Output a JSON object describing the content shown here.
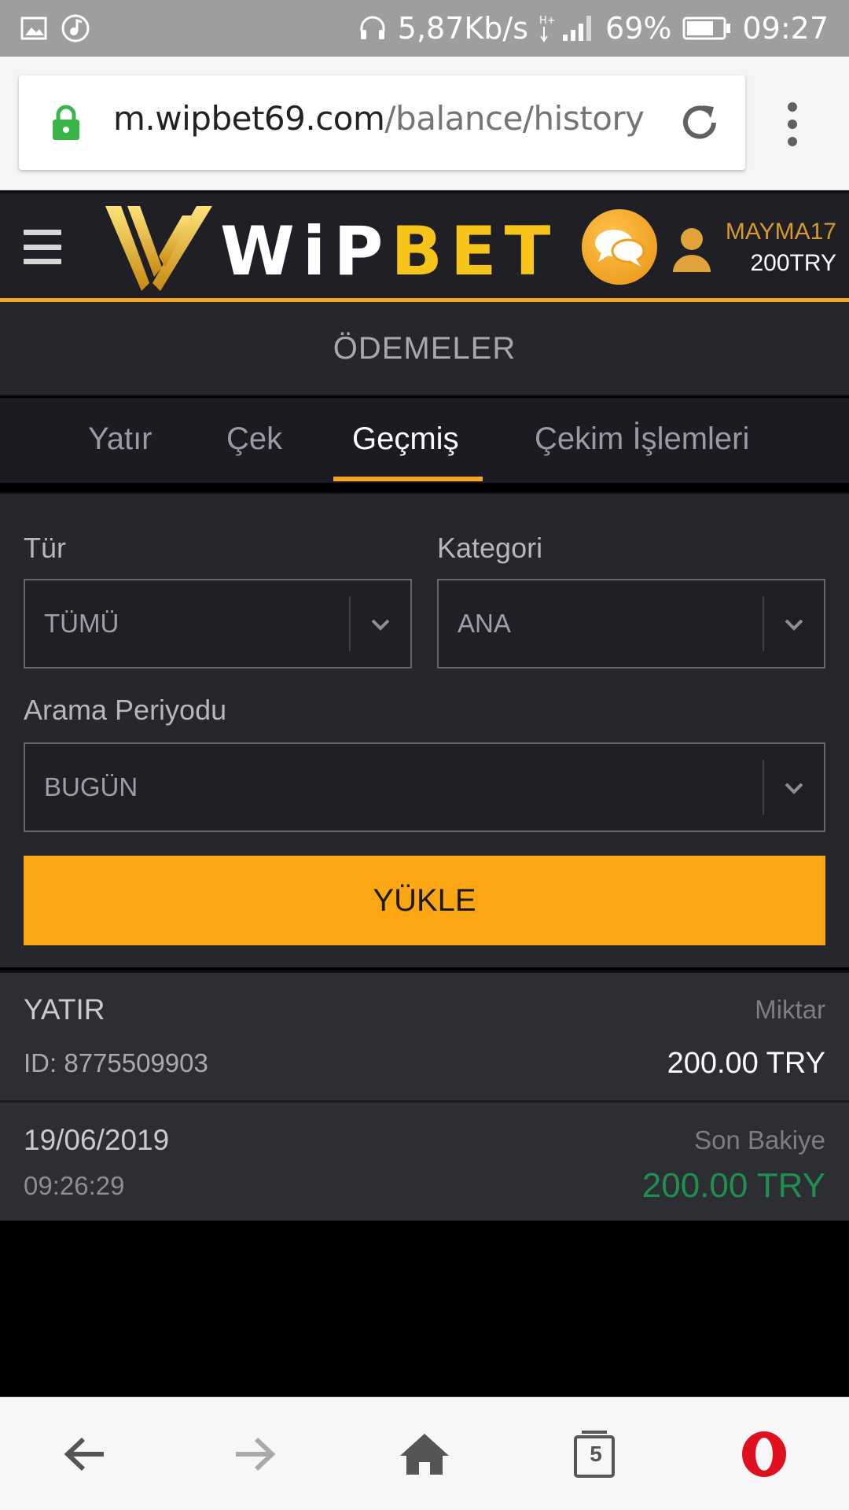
{
  "status_bar": {
    "net_speed": "5,87Kb/s",
    "battery": "69%",
    "time": "09:27"
  },
  "browser": {
    "url_host": "m.wipbet69.com",
    "url_path": "/balance/history",
    "tab_count": "5"
  },
  "header": {
    "logo_wip": "WiP",
    "logo_bet": "BET",
    "username": "MAYMA17",
    "balance": "200TRY"
  },
  "page": {
    "title": "ÖDEMELER"
  },
  "tabs": [
    {
      "label": "Yatır"
    },
    {
      "label": "Çek"
    },
    {
      "label": "Geçmiş"
    },
    {
      "label": "Çekim İşlemleri"
    }
  ],
  "filters": {
    "type_label": "Tür",
    "type_value": "TÜMÜ",
    "category_label": "Kategori",
    "category_value": "ANA",
    "period_label": "Arama Periyodu",
    "period_value": "BUGÜN",
    "load_label": "YÜKLE"
  },
  "transaction": {
    "type": "YATIR",
    "id": "ID: 8775509903",
    "amount_label": "Miktar",
    "amount": "200.00 TRY",
    "date": "19/06/2019",
    "time": "09:26:29",
    "balance_label": "Son Bakiye",
    "balance": "200.00 TRY"
  },
  "colors": {
    "accent": "#f5a623",
    "button": "#fda613",
    "positive": "#1f8e4f",
    "header_bg": "#1f1f25"
  }
}
